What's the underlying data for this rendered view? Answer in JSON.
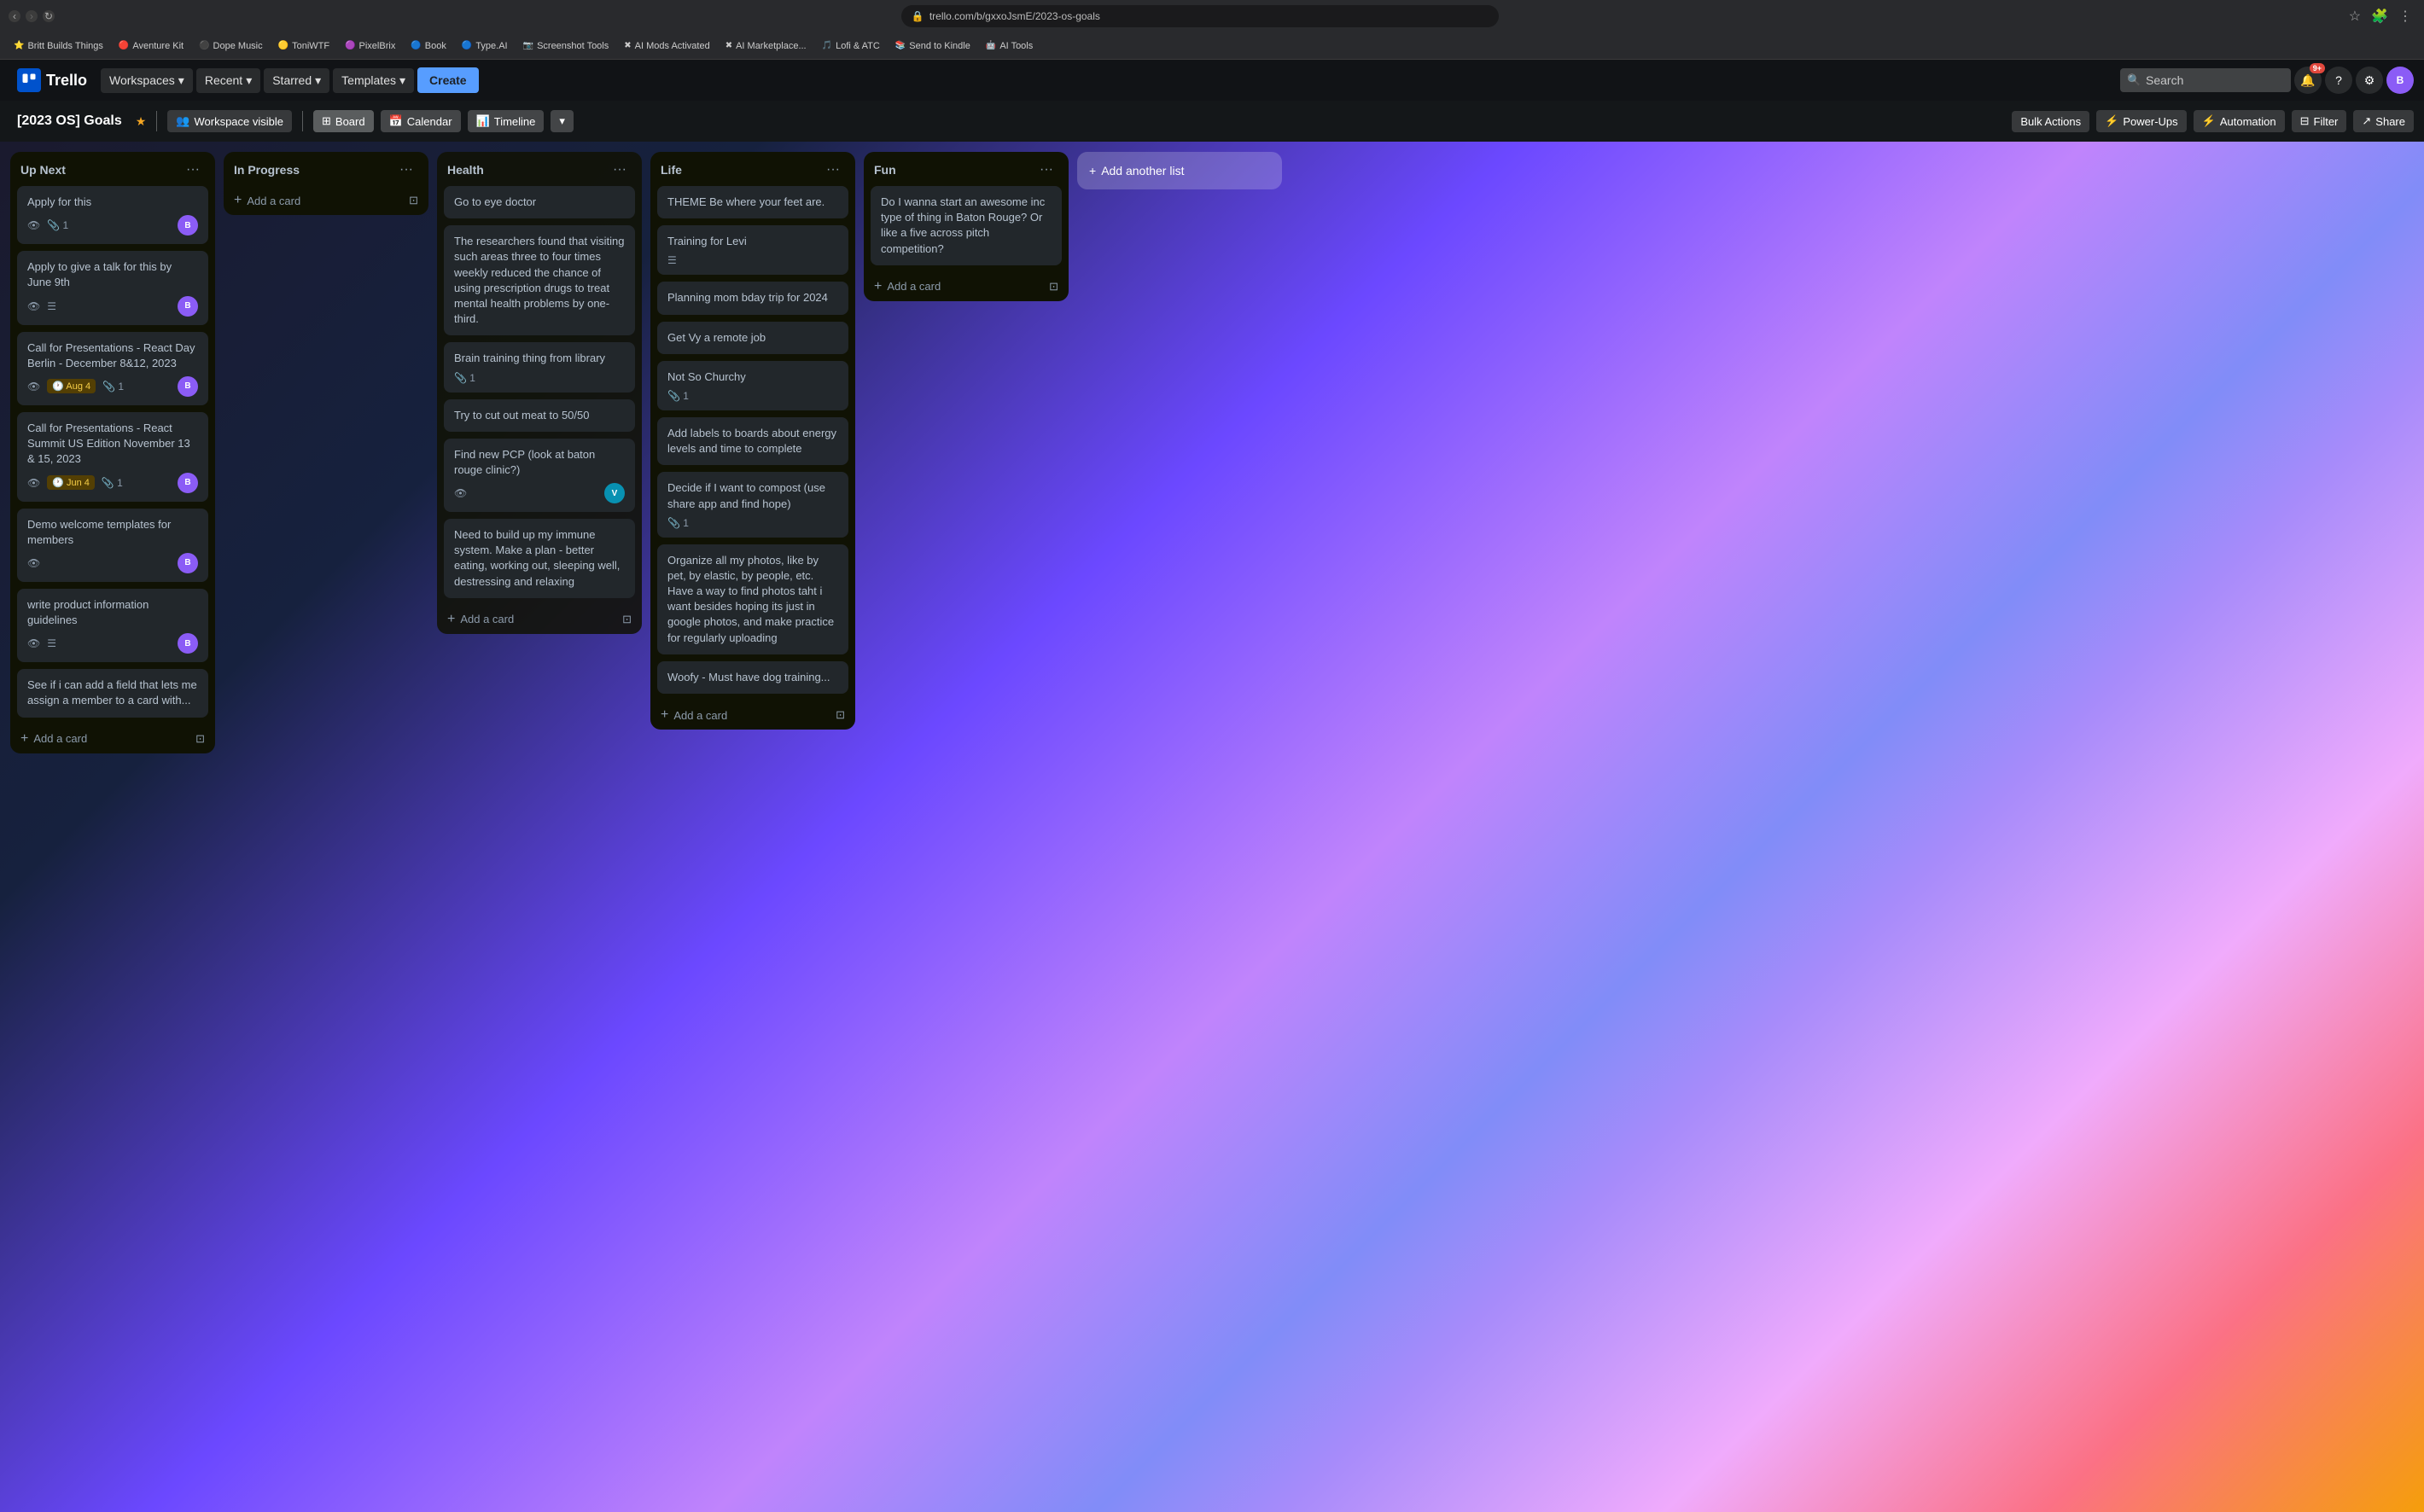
{
  "browser": {
    "url": "trello.com/b/gxxoJsmE/2023-os-goals",
    "bookmarks": [
      {
        "label": "Britt Builds Things",
        "icon": "⭐"
      },
      {
        "label": "Aventure Kit",
        "icon": "🔴"
      },
      {
        "label": "Dope Music",
        "icon": "⚫"
      },
      {
        "label": "ToniWTF",
        "icon": "🟡"
      },
      {
        "label": "PixelBrix",
        "icon": "🟣"
      },
      {
        "label": "Book",
        "icon": "🔵"
      },
      {
        "label": "Type.AI",
        "icon": "🔵"
      },
      {
        "label": "Screenshot Tools",
        "icon": "📷"
      },
      {
        "label": "AI Mods Activated",
        "icon": "✖"
      },
      {
        "label": "AI Marketplace...",
        "icon": "✖"
      },
      {
        "label": "Lofi & ATC",
        "icon": "🎵"
      },
      {
        "label": "Send to Kindle",
        "icon": "📚"
      },
      {
        "label": "AI Tools",
        "icon": "🤖"
      }
    ]
  },
  "trello_nav": {
    "logo": "Trello",
    "workspaces": "Workspaces",
    "recent": "Recent",
    "starred": "Starred",
    "templates": "Templates",
    "create": "Create",
    "search_placeholder": "Search",
    "notification_count": "9+"
  },
  "board_header": {
    "title": "[2023 OS] Goals",
    "visibility": "Workspace visible",
    "views": [
      "Board",
      "Calendar",
      "Timeline"
    ],
    "active_view": "Board",
    "actions": [
      "Bulk Actions",
      "Power-Ups",
      "Automation",
      "Filter",
      "Share"
    ]
  },
  "lists": [
    {
      "id": "up-next",
      "title": "Up Next",
      "cards": [
        {
          "title": "Apply for this",
          "meta": [
            {
              "type": "eye"
            },
            {
              "type": "attach",
              "count": "1"
            }
          ],
          "avatar": "purple"
        },
        {
          "title": "Apply to give a talk for this by June 9th",
          "meta": [
            {
              "type": "eye"
            },
            {
              "type": "list"
            }
          ],
          "avatar": "purple"
        },
        {
          "title": "Call for Presentations - React Day Berlin - December 8&12, 2023",
          "meta": [
            {
              "type": "eye"
            },
            {
              "type": "date",
              "label": "Aug 4"
            },
            {
              "type": "attach",
              "count": "1"
            }
          ],
          "avatar": "purple"
        },
        {
          "title": "Call for Presentations - React Summit US Edition November 13 & 15, 2023",
          "meta": [
            {
              "type": "eye"
            },
            {
              "type": "date",
              "label": "Jun 4"
            },
            {
              "type": "attach",
              "count": "1"
            }
          ],
          "avatar": "purple"
        },
        {
          "title": "Demo welcome templates for members",
          "meta": [
            {
              "type": "eye"
            }
          ],
          "avatar": "purple"
        },
        {
          "title": "write product information guidelines",
          "meta": [
            {
              "type": "eye"
            },
            {
              "type": "list"
            }
          ],
          "avatar": "purple"
        },
        {
          "title": "See if i can add a field that lets me assign a member to a card with...",
          "meta": [],
          "avatar": null
        }
      ],
      "add_card": "Add a card"
    },
    {
      "id": "in-progress",
      "title": "In Progress",
      "cards": [],
      "add_card": "Add a card"
    },
    {
      "id": "health",
      "title": "Health",
      "cards": [
        {
          "title": "Go to eye doctor",
          "meta": [],
          "avatar": null
        },
        {
          "title": "The researchers found that visiting such areas three to four times weekly reduced the chance of using prescription drugs to treat mental health problems by one-third.",
          "meta": [],
          "avatar": null
        },
        {
          "title": "Brain training thing from library",
          "meta": [
            {
              "type": "attach",
              "count": "1"
            }
          ],
          "avatar": null
        },
        {
          "title": "Try to cut out meat to 50/50",
          "meta": [],
          "avatar": null
        },
        {
          "title": "Find new PCP (look at baton rouge clinic?)",
          "meta": [
            {
              "type": "eye"
            }
          ],
          "avatar": "teal"
        },
        {
          "title": "Need to build up my immune system. Make a plan - better eating, working out, sleeping well, destressing and relaxing",
          "meta": [],
          "avatar": null
        }
      ],
      "add_card": "Add a card"
    },
    {
      "id": "life",
      "title": "Life",
      "cards": [
        {
          "title": "THEME Be where your feet are.",
          "meta": [],
          "avatar": null
        },
        {
          "title": "Training for Levi",
          "meta": [
            {
              "type": "list"
            }
          ],
          "avatar": null
        },
        {
          "title": "Planning mom bday trip for 2024",
          "meta": [],
          "avatar": null
        },
        {
          "title": "Get Vy a remote job",
          "meta": [],
          "avatar": null
        },
        {
          "title": "Not So Churchy",
          "meta": [
            {
              "type": "attach",
              "count": "1"
            }
          ],
          "avatar": null
        },
        {
          "title": "Add labels to boards about energy levels and time to complete",
          "meta": [],
          "avatar": null
        },
        {
          "title": "Decide if I want to compost (use share app and find hope)",
          "meta": [
            {
              "type": "attach",
              "count": "1"
            }
          ],
          "avatar": null
        },
        {
          "title": "Organize all my photos, like by pet, by elastic, by people, etc. Have a way to find photos taht i want besides hoping its just in google photos, and make practice for regularly uploading",
          "meta": [],
          "avatar": null
        },
        {
          "title": "Woofy - Must have dog training...",
          "meta": [],
          "avatar": null
        }
      ],
      "add_card": "Add a card"
    },
    {
      "id": "fun",
      "title": "Fun",
      "cards": [
        {
          "title": "Do I wanna start an awesome inc type of thing in Baton Rouge? Or like a five across pitch competition?",
          "meta": [],
          "avatar": null
        }
      ],
      "add_card": "Add a card"
    }
  ],
  "icons": {
    "eye": "👁",
    "attach": "📎",
    "clock": "🕐",
    "list": "☰",
    "plus": "+",
    "more": "···",
    "star": "★",
    "search": "🔍",
    "people": "👥",
    "calendar": "📅",
    "timeline": "📊",
    "board_icon": "⊞",
    "lightning": "⚡",
    "filter": "⊟"
  }
}
